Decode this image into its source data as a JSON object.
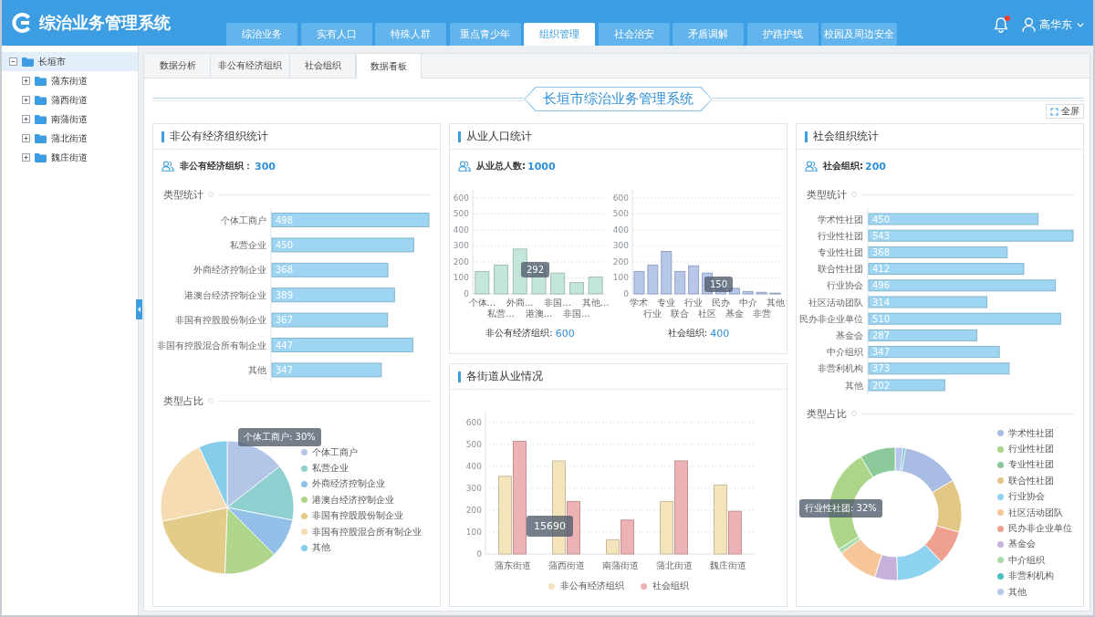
{
  "header": {
    "title": "综治业务管理系统",
    "nav": [
      {
        "label": "综治业务",
        "selected": false
      },
      {
        "label": "实有人口",
        "selected": false
      },
      {
        "label": "特殊人群",
        "selected": false
      },
      {
        "label": "重点青少年",
        "selected": false
      },
      {
        "label": "组织管理",
        "selected": true
      },
      {
        "label": "社会治安",
        "selected": false
      },
      {
        "label": "矛盾调解",
        "selected": false
      },
      {
        "label": "护路护线",
        "selected": false
      },
      {
        "label": "校园及周边安全",
        "selected": false
      }
    ],
    "notifications": {
      "unread": true
    },
    "user": {
      "name": "高华东"
    }
  },
  "sidebar": {
    "tree": [
      {
        "label": "长垣市",
        "expanded": true,
        "selected": true,
        "children": [
          {
            "label": "蒲东街道",
            "expanded": false,
            "selected": false
          },
          {
            "label": "蒲西街道",
            "expanded": false,
            "selected": false
          },
          {
            "label": "南蒲街道",
            "expanded": false,
            "selected": false
          },
          {
            "label": "蒲北街道",
            "expanded": false,
            "selected": false
          },
          {
            "label": "魏庄街道",
            "expanded": false,
            "selected": false
          }
        ]
      }
    ]
  },
  "subtabs": [
    {
      "label": "数据分析",
      "selected": false
    },
    {
      "label": "非公有经济组织",
      "selected": false
    },
    {
      "label": "社会组织",
      "selected": false
    },
    {
      "label": "数据看板",
      "selected": true
    }
  ],
  "dashboard": {
    "banner": "长垣市综治业务管理系统",
    "fullscreen_button": "全屏"
  },
  "nonpublic_panel": {
    "title": "非公有经济组织统计",
    "stat": {
      "label": "非公有经济组织：",
      "value": "300"
    },
    "type_stats": {
      "heading": "类型统计",
      "chart_data": {
        "type": "bar",
        "orientation": "horizontal",
        "categories": [
          "个体工商户",
          "私营企业",
          "外商经济控制企业",
          "港澳台经济控制企业",
          "非国有控股股份制企业",
          "非国有控股混合所有制企业",
          "其他"
        ],
        "series": [
          {
            "color": "#9dd5f2",
            "values": [
              498,
              450,
              368,
              389,
              367,
              447,
              347
            ]
          }
        ],
        "data_labels": true
      }
    },
    "type_share": {
      "heading": "类型占比",
      "tooltip": "个体工商户: 30%",
      "legend": [
        {
          "label": "个体工商户",
          "color": "#b4c6e7"
        },
        {
          "label": "私营企业",
          "color": "#8ecfcf"
        },
        {
          "label": "外商经济控制企业",
          "color": "#92c0e8"
        },
        {
          "label": "港澳台经济控制企业",
          "color": "#b0d68c"
        },
        {
          "label": "非国有控股股份制企业",
          "color": "#e3cb89"
        },
        {
          "label": "非国有控股混合所有制企业",
          "color": "#f5dcb2"
        },
        {
          "label": "其他",
          "color": "#86cdec"
        }
      ]
    }
  },
  "employment_panel": {
    "title": "从业人口统计",
    "stat": {
      "label": "从业总人数:",
      "value": "1000"
    },
    "charts": [
      {
        "chart_data": {
          "type": "bar",
          "categories": [
            "个体...",
            "私营...",
            "外商...",
            "港澳...",
            "非国...",
            "非国...",
            "其他..."
          ],
          "series": [
            {
              "color": "#c4e6d8",
              "values": [
                140,
                180,
                280,
                175,
                130,
                70,
                105
              ]
            }
          ],
          "ylim": [
            0,
            650
          ],
          "yticks": [
            0,
            100,
            200,
            300,
            400,
            500,
            600
          ],
          "grid": true
        },
        "tooltip": "292",
        "caption": {
          "label": "非公有经济组织:",
          "value": "600"
        }
      },
      {
        "chart_data": {
          "type": "bar",
          "categories": [
            "学术",
            "行业",
            "专业",
            "联合",
            "行业",
            "社区",
            "民办",
            "基金",
            "中介",
            "非营",
            "其他"
          ],
          "series": [
            {
              "color": "#b6c7ea",
              "values": [
                140,
                180,
                265,
                140,
                175,
                130,
                70,
                35,
                15,
                10,
                5
              ]
            }
          ],
          "ylim": [
            0,
            650
          ],
          "yticks": [
            0,
            100,
            200,
            300,
            400,
            500,
            600
          ],
          "grid": true
        },
        "tooltip": "150",
        "caption": {
          "label": "社会组织:",
          "value": "400"
        }
      }
    ]
  },
  "street_panel": {
    "title": "各街道从业情况",
    "chart_data": {
      "type": "bar",
      "categories": [
        "蒲东街道",
        "蒲西街道",
        "南蒲街道",
        "蒲北街道",
        "魏庄街道"
      ],
      "series": [
        {
          "name": "非公有经济组织",
          "color": "#f3e4bb",
          "values": [
            355,
            425,
            65,
            240,
            315
          ]
        },
        {
          "name": "社会组织",
          "color": "#edb2b4",
          "values": [
            515,
            240,
            155,
            425,
            195
          ]
        }
      ],
      "ylim": [
        0,
        650
      ],
      "yticks": [
        0,
        100,
        200,
        300,
        400,
        500,
        600
      ],
      "grid": true
    },
    "tooltip": "15690"
  },
  "social_panel": {
    "title": "社会组织统计",
    "stat": {
      "label": "社会组织:",
      "value": "200"
    },
    "type_stats": {
      "heading": "类型统计",
      "chart_data": {
        "type": "bar",
        "orientation": "horizontal",
        "categories": [
          "学术性社团",
          "行业性社团",
          "专业性社团",
          "联合性社团",
          "行业协会",
          "社区活动团队",
          "民办非企业单位",
          "基金会",
          "中介组织",
          "非营利机构",
          "其他"
        ],
        "series": [
          {
            "color": "#9dd5f2",
            "values": [
              450,
              543,
              368,
              412,
              496,
              314,
              510,
              287,
              347,
              373,
              202
            ]
          }
        ],
        "data_labels": true
      }
    },
    "type_share": {
      "heading": "类型占比",
      "tooltip": "行业性社团: 32%",
      "legend": [
        {
          "label": "学术性社团",
          "color": "#a9bce4"
        },
        {
          "label": "行业性社团",
          "color": "#add58a"
        },
        {
          "label": "专业性社团",
          "color": "#8cc99a"
        },
        {
          "label": "联合性社团",
          "color": "#e2c784"
        },
        {
          "label": "行业协会",
          "color": "#8dd2ee"
        },
        {
          "label": "社区活动团队",
          "color": "#f6c69a"
        },
        {
          "label": "民办非企业单位",
          "color": "#efa08f"
        },
        {
          "label": "基金会",
          "color": "#c5b1d9"
        },
        {
          "label": "中介组织",
          "color": "#a9dbaa"
        },
        {
          "label": "非营利机构",
          "color": "#4dbdc4"
        },
        {
          "label": "其他",
          "color": "#b9c7ec"
        }
      ]
    }
  }
}
